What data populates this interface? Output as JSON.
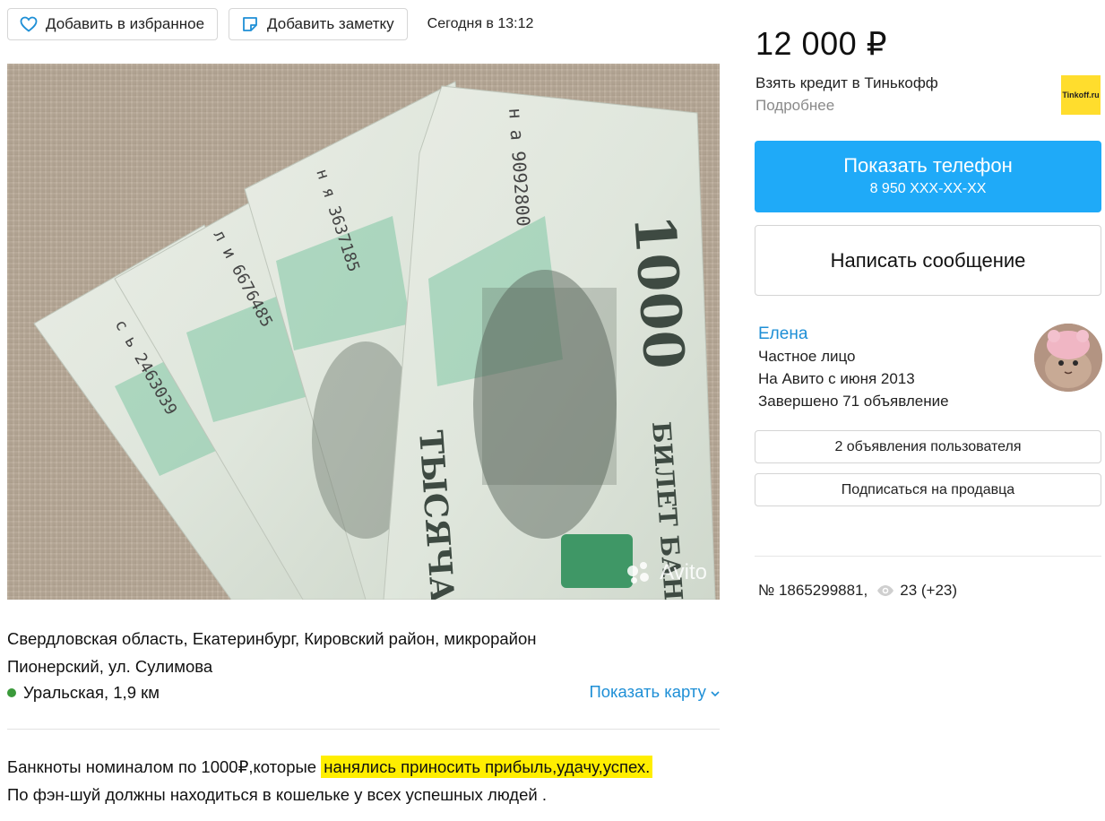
{
  "topbar": {
    "favorite_label": "Добавить в избранное",
    "note_label": "Добавить заметку",
    "date": "Сегодня в 13:12"
  },
  "photo": {
    "watermark": "Avito"
  },
  "location": {
    "address_line1": "Свердловская область, Екатеринбург, Кировский район, микрорайон",
    "address_line2": "Пионерский, ул. Сулимова",
    "metro": "Уральская, 1,9 км",
    "metro_color": "#3b9a3b",
    "map_link": "Показать карту"
  },
  "description": {
    "line1_plain": "Банкноты номиналом по 1000₽,которые ",
    "line1_highlight": "нанялись приносить прибыль,удачу,успех.",
    "line2": "По фэн-шуй должны находиться в кошельке у всех успешных людей .",
    "highlight_color": "#ffee00"
  },
  "sidebar": {
    "price": "12 000 ₽",
    "credit_text": "Взять кредит в Тинькофф",
    "credit_more": "Подробнее",
    "bank_logo_text": "Tinkoff.ru",
    "phone_button_label": "Показать телефон",
    "phone_button_number": "8 950 XXX-XX-XX",
    "message_button_label": "Написать сообщение",
    "accent_color": "#1faaf8"
  },
  "seller": {
    "name": "Елена",
    "type": "Частное лицо",
    "since": "На Авито с июня 2013",
    "completed": "Завершено 71 объявление",
    "ads_button": "2 объявления пользователя",
    "subscribe_button": "Подписаться на продавца"
  },
  "meta": {
    "ad_number": "№ 1865299881,",
    "views": "23 (+23)"
  }
}
